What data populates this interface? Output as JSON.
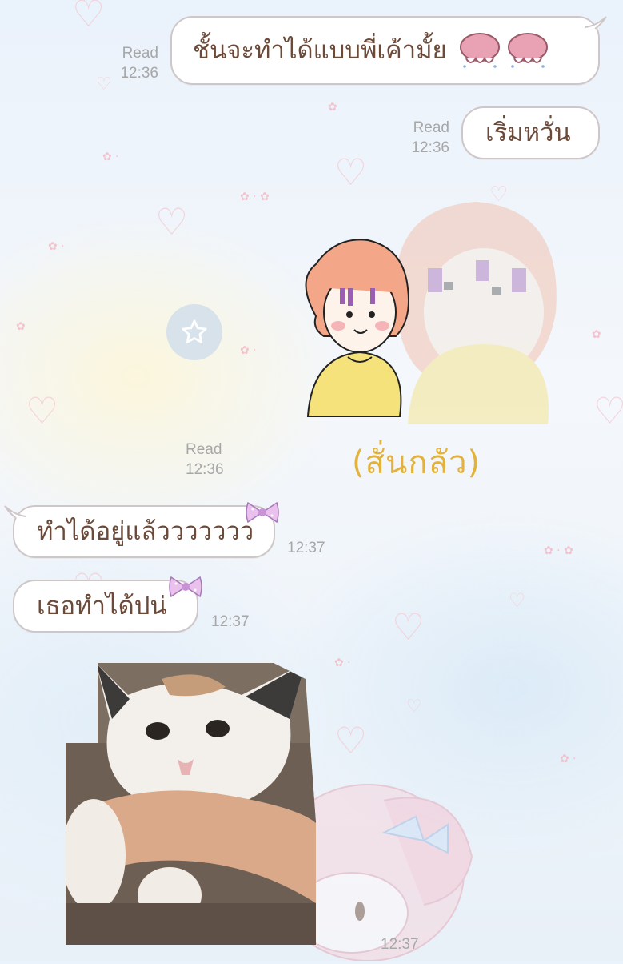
{
  "messages": [
    {
      "id": "m1",
      "text": "ชั้นจะทำได้แบบพี่เค้ามั้ย",
      "read_label": "Read",
      "time": "12:36",
      "side": "right"
    },
    {
      "id": "m2",
      "text": "เริ่มหวั่น",
      "read_label": "Read",
      "time": "12:36",
      "side": "right"
    },
    {
      "id": "m3",
      "sticker_caption": "(สั่นกลัว)",
      "read_label": "Read",
      "time": "12:36",
      "side": "right",
      "type": "sticker"
    },
    {
      "id": "m4",
      "text": "ทำได้อยู่แล้ววววววว",
      "time": "12:37",
      "side": "left"
    },
    {
      "id": "m5",
      "text": "เธอทำได้ปน่",
      "time": "12:37",
      "side": "left"
    },
    {
      "id": "m6",
      "type": "photo",
      "time": "12:37",
      "side": "left",
      "photo_subject": "cat-biting-hand"
    }
  ],
  "icons": {
    "favorite": "star-icon",
    "emoji": "paw-emoji-icon",
    "bubble_deco": "bow-icon"
  },
  "colors": {
    "bubble_text": "#6b4a3a",
    "bubble_border": "#cfc7c7",
    "meta_text": "#a7a7a7",
    "sticker_caption": "#e2b23a",
    "favorite_button": "#d7e2ea"
  }
}
